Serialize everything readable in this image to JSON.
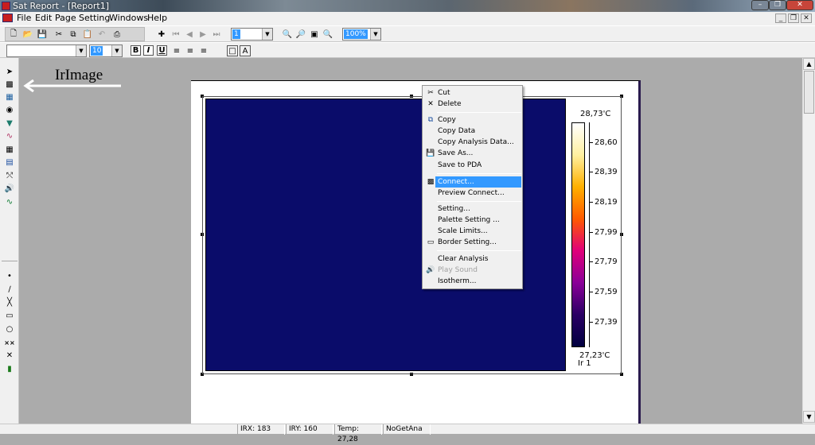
{
  "window": {
    "title": "Sat Report - [Report1]"
  },
  "menubar": {
    "items": [
      "File",
      "Edit",
      "Page",
      "Setting",
      "Windows",
      "Help"
    ]
  },
  "toolbar1": {
    "page_combo": "1",
    "zoom_combo": "100%"
  },
  "toolbar2": {
    "font_combo": "",
    "size_combo": "10"
  },
  "annotation": {
    "label": "IrImage"
  },
  "irimage": {
    "scale_max": "28,73'C",
    "scale_min": "27,23'C",
    "scale_ticks": [
      "28,60",
      "28,39",
      "28,19",
      "27,99",
      "27,79",
      "27,59",
      "27,39"
    ],
    "image_label": "Ir 1",
    "colors": {
      "image_bg": "#0a0c6a",
      "palette": [
        "#ffffff",
        "#fff0a0",
        "#ffb000",
        "#ff5a00",
        "#e0007a",
        "#8a0098",
        "#2a0064",
        "#000040"
      ]
    }
  },
  "context_menu": {
    "items": [
      {
        "label": "Cut",
        "icon": "scissors-icon",
        "disabled": false,
        "highlighted": false
      },
      {
        "label": "Delete",
        "icon": "delete-x-icon",
        "disabled": false,
        "highlighted": false
      },
      {
        "label": "Copy",
        "icon": "copy-icon",
        "disabled": false,
        "highlighted": false
      },
      {
        "label": "Copy Data",
        "icon": "",
        "disabled": false,
        "highlighted": false
      },
      {
        "label": "Copy Analysis Data...",
        "icon": "",
        "disabled": false,
        "highlighted": false
      },
      {
        "label": "Save As...",
        "icon": "floppy-icon",
        "disabled": false,
        "highlighted": false
      },
      {
        "label": "Save to PDA",
        "icon": "",
        "disabled": false,
        "highlighted": false
      },
      {
        "label": "Connect...",
        "icon": "camera-connect-icon",
        "disabled": false,
        "highlighted": true
      },
      {
        "label": "Preview Connect...",
        "icon": "",
        "disabled": false,
        "highlighted": false
      },
      {
        "label": "Setting...",
        "icon": "",
        "disabled": false,
        "highlighted": false
      },
      {
        "label": "Palette Setting ...",
        "icon": "",
        "disabled": false,
        "highlighted": false
      },
      {
        "label": "Scale Limits...",
        "icon": "",
        "disabled": false,
        "highlighted": false
      },
      {
        "label": "Border Setting...",
        "icon": "border-rect-icon",
        "disabled": false,
        "highlighted": false
      },
      {
        "label": "Clear Analysis",
        "icon": "",
        "disabled": false,
        "highlighted": false
      },
      {
        "label": "Play Sound",
        "icon": "speaker-icon",
        "disabled": true,
        "highlighted": false
      },
      {
        "label": "Isotherm...",
        "icon": "",
        "disabled": false,
        "highlighted": false
      }
    ]
  },
  "statusbar": {
    "cells": [
      "IRX: 183",
      "IRY: 160",
      "Temp: 27,28",
      "NoGetAna"
    ]
  },
  "colors": {
    "accent": "#3399ff",
    "workspace": "#ababab"
  }
}
